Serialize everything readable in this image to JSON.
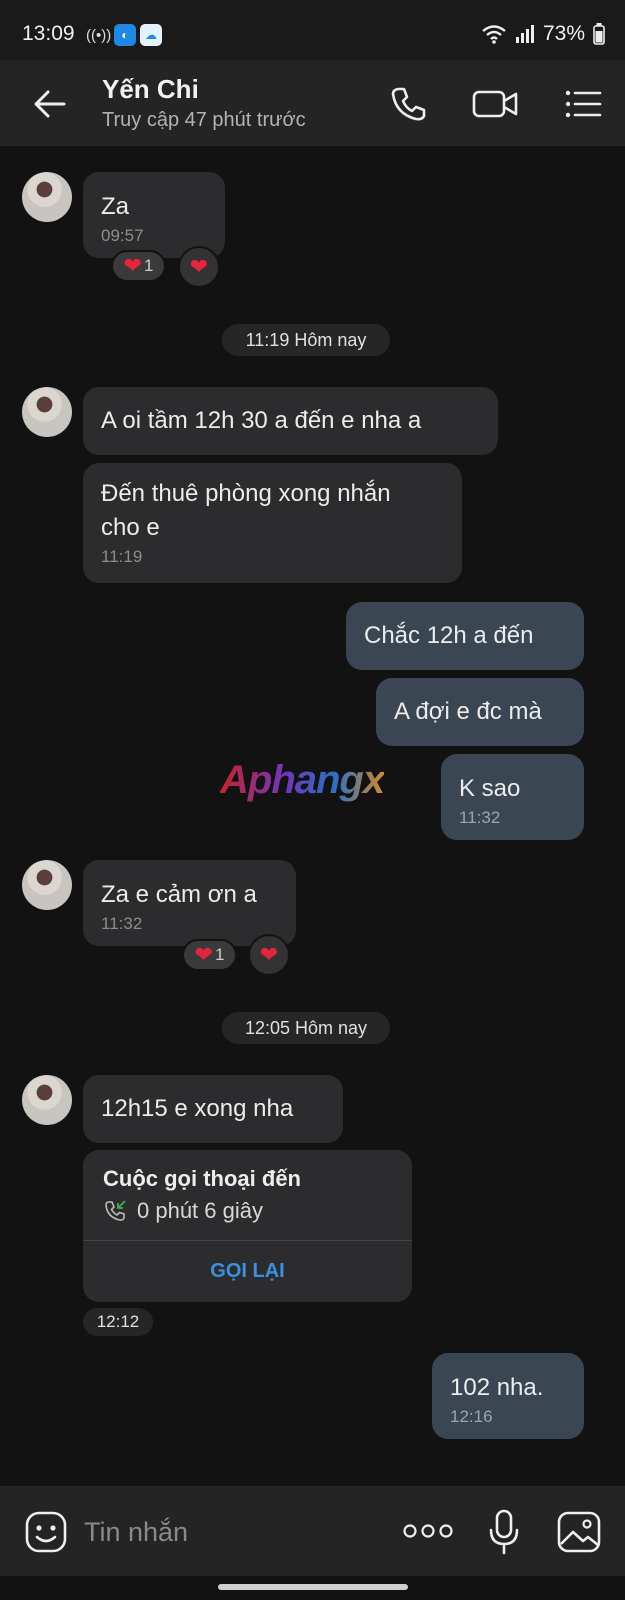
{
  "status_bar": {
    "time": "13:09",
    "battery": "73%"
  },
  "header": {
    "contact_name": "Yến Chi",
    "last_seen": "Truy cập 47 phút trước"
  },
  "messages": {
    "m1": {
      "text": "Za",
      "time": "09:57",
      "reaction_count": "1"
    },
    "sep1": "11:19 Hôm nay",
    "m2": {
      "text": "A oi tầm 12h 30 a đến e nha a"
    },
    "m3": {
      "line1": "Đến thuê phòng xong nhắn",
      "line2": "cho e",
      "time": "11:19"
    },
    "m4": {
      "text": "Chắc 12h a đến"
    },
    "m5": {
      "text": "A đợi e đc mà"
    },
    "m6": {
      "text": "K sao",
      "time": "11:32"
    },
    "m7": {
      "text": "Za e cảm ơn a",
      "time": "11:32",
      "reaction_count": "1"
    },
    "sep2": "12:05 Hôm nay",
    "m8": {
      "text": "12h15 e xong nha"
    },
    "call": {
      "title": "Cuộc gọi thoại đến",
      "duration": "0 phút 6 giây",
      "callback": "GỌI LẠI",
      "time": "12:12"
    },
    "m9": {
      "text": "102 nha.",
      "time": "12:16"
    }
  },
  "watermark": "Aphangx",
  "composer": {
    "placeholder": "Tin nhắn"
  },
  "colors": {
    "incoming": "#2c2c2e",
    "outgoing": "#3b4653",
    "accent": "#3d8fe0",
    "heart": "#e8243c"
  }
}
